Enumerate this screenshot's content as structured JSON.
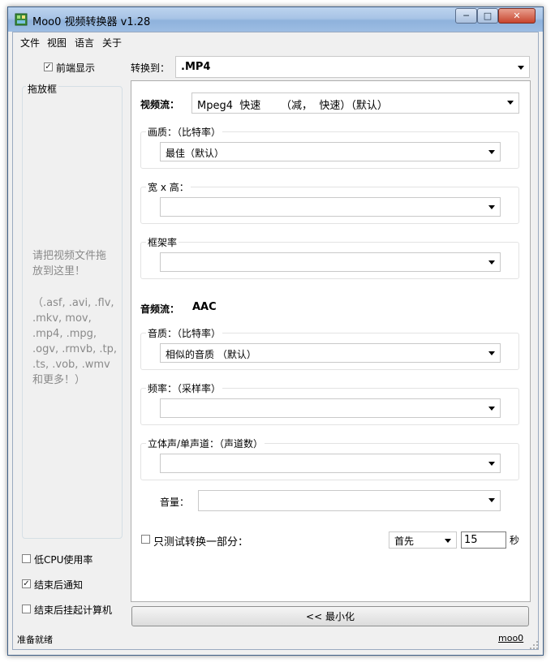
{
  "window": {
    "title": "Moo0 视频转换器 v1.28"
  },
  "menu": [
    "文件",
    "视图",
    "语言",
    "关于"
  ],
  "left": {
    "ontop_label": "前端显示",
    "dropbox_title": "拖放框",
    "hint_line1": "请把视频文件拖",
    "hint_line2": "放到这里！",
    "formats": [
      "（.asf, .avi, .flv,",
      ".mkv, mov,",
      ".mp4, .mpg,",
      ".ogv, .rmvb, .tp,",
      ".ts, .vob, .wmv",
      "和更多！）"
    ],
    "low_cpu_label": "低CPU使用率",
    "notify_label": "结束后通知",
    "suspend_label": "结束后挂起计算机"
  },
  "convert": {
    "label": "转换到：",
    "value": ".MP4"
  },
  "video": {
    "label": "视频流：",
    "codec": "Mpeg4  快速      （减，  快速）（默认）",
    "quality_label": "画质：（比特率）",
    "quality_value": "最佳（默认）",
    "size_label": "宽 x 高：",
    "size_value": "",
    "fps_label": "框架率",
    "fps_value": ""
  },
  "audio": {
    "label": "音频流：",
    "codec": "AAC",
    "quality_label": "音质：（比特率）",
    "quality_value": "相似的音质 （默认）",
    "rate_label": "频率：（采样率）",
    "rate_value": "",
    "channels_label": "立体声/单声道：（声道数）",
    "channels_value": "",
    "volume_label": "音量：",
    "volume_value": ""
  },
  "test": {
    "label": "只测试转换一部分：",
    "position": "首先",
    "seconds": "15",
    "unit": "秒"
  },
  "minimize_button": "<< 最小化",
  "status": {
    "text": "准备就绪",
    "link": "moo0"
  },
  "checked": {
    "ontop": true,
    "low_cpu": false,
    "notify": true,
    "suspend": false,
    "test": false
  }
}
